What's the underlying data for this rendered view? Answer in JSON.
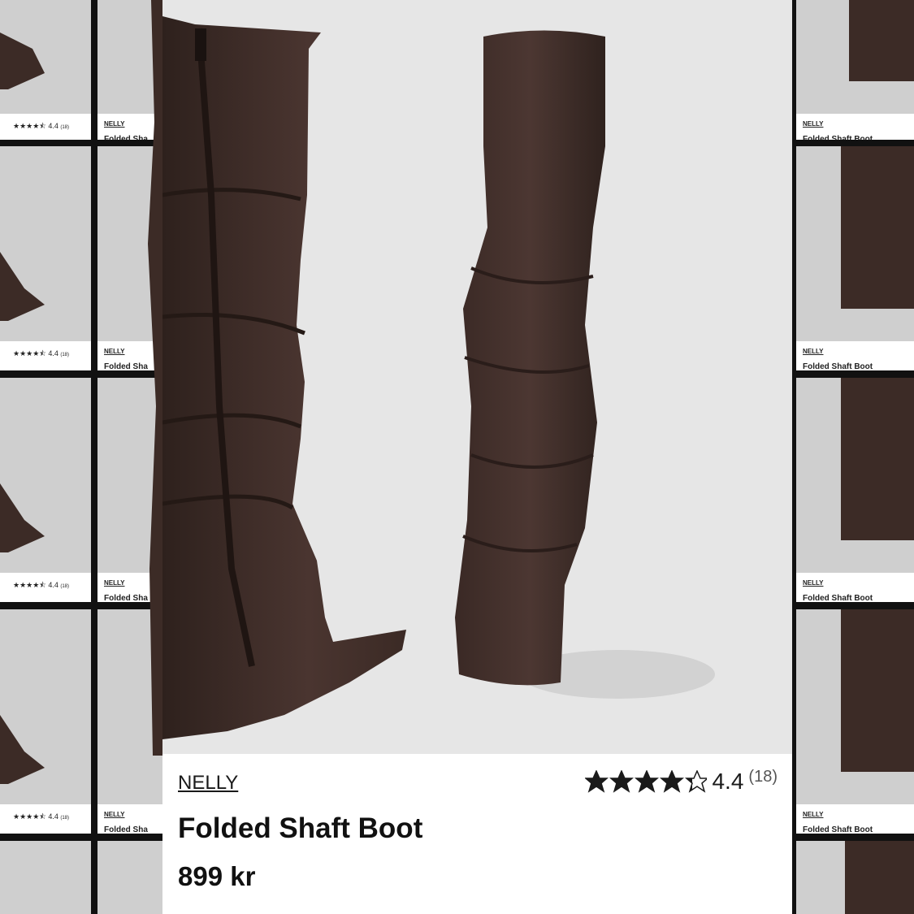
{
  "product": {
    "brand": "NELLY",
    "title": "Folded Shaft Boot",
    "price": "899 kr",
    "rating": "4.4",
    "review_count": "(18)",
    "star_fill": 0.88
  },
  "background_grid": {
    "rating_text": "4.4",
    "review_count": "(18)",
    "brand": "NELLY",
    "title": "Folded Shaft Boot",
    "title_cut": "Folded Sha"
  },
  "colors": {
    "boot_brown": "#3c2b26",
    "boot_brown_shadow": "#2a1d1a",
    "photo_bg": "#e6e6e6"
  }
}
